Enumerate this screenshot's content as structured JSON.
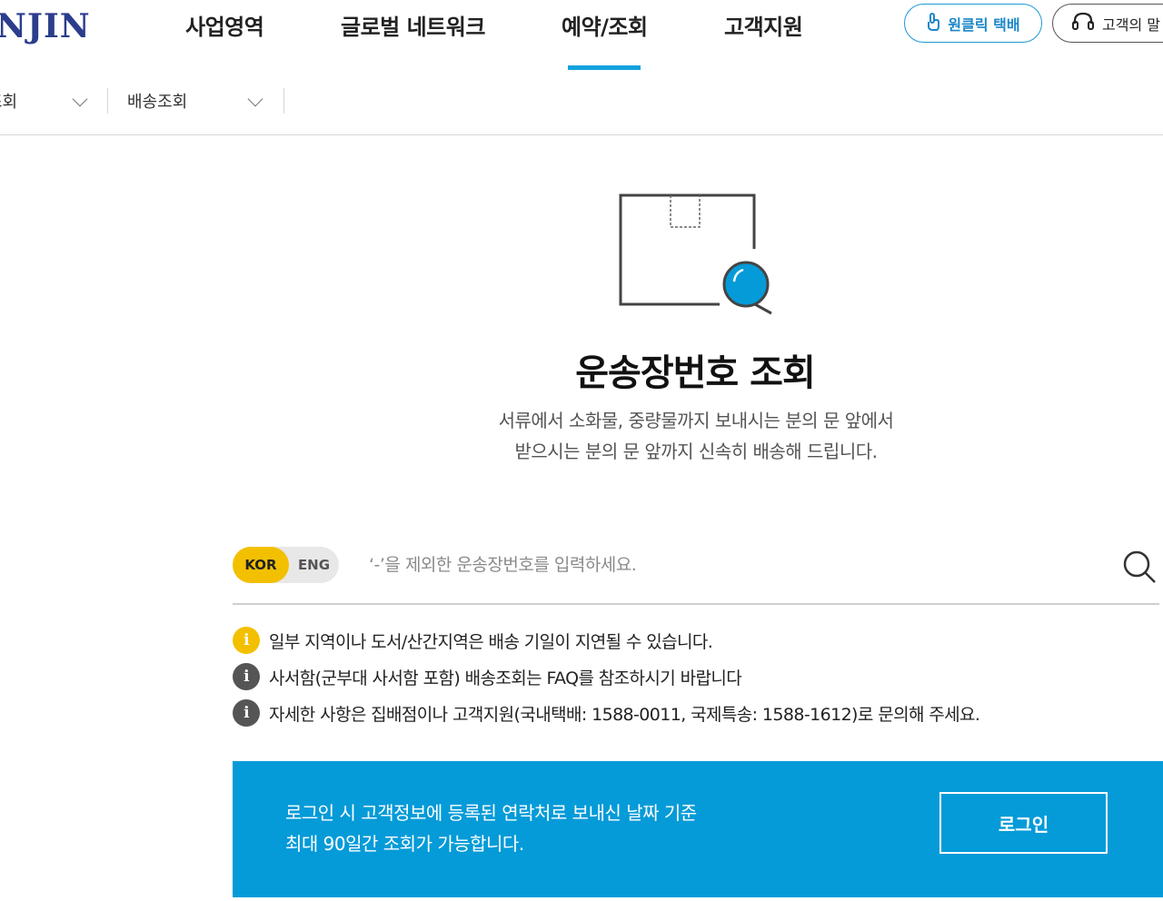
{
  "header": {
    "logo": "NJIN",
    "nav": [
      {
        "label": "사업영역"
      },
      {
        "label": "글로벌 네트워크"
      },
      {
        "label": "예약/조회"
      },
      {
        "label": "고객지원"
      }
    ],
    "active_nav": "예약/조회",
    "oneclick_label": "원클릭 택배",
    "voice_label": "고객의 말"
  },
  "subnav": {
    "items": [
      {
        "label": "조회"
      },
      {
        "label": "배송조회"
      }
    ]
  },
  "hero": {
    "title": "운송장번호 조회",
    "desc_line1": "서류에서 소화물, 중량물까지 보내시는 분의 문 앞에서",
    "desc_line2": "받으시는 분의 문 앞까지 신속히 배송해 드립니다."
  },
  "search": {
    "lang_kor": "KOR",
    "lang_eng": "ENG",
    "selected_lang": "KOR",
    "placeholder": "‘-’을 제외한 운송장번호를 입력하세요.",
    "value": ""
  },
  "notices": [
    {
      "icon": "info-icon",
      "color": "#f3c000",
      "text": "일부 지역이나 도서/산간지역은 배송 기일이 지연될 수 있습니다."
    },
    {
      "icon": "info-icon",
      "color": "#555555",
      "text": "사서함(군부대 사서함 포함) 배송조회는 FAQ를 참조하시기 바랍니다"
    },
    {
      "icon": "info-icon",
      "color": "#555555",
      "text": "자세한 사항은 집배점이나 고객지원(국내택배: 1588-0011, 국제특송: 1588-1612)로 문의해 주세요."
    }
  ],
  "login_banner": {
    "line1": "로그인 시 고객정보에 등록된 연락처로 보내신 날짜 기준",
    "line2": "최대 90일간 조회가 가능합니다.",
    "button_label": "로그인"
  },
  "colors": {
    "accent_blue": "#049bd8",
    "accent_yellow": "#f3c000",
    "logo_navy": "#2b3d8c"
  }
}
